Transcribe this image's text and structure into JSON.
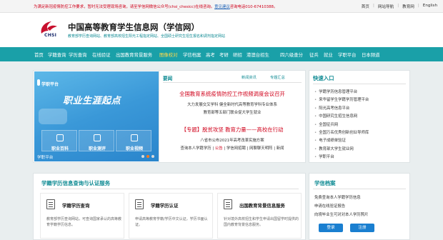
{
  "topbar": {
    "notice_before": "为满足新冠疫情防控工作要求，暂时无法受理现场咨询，请至学信网微信公众号(chsi_chesicc)在线咨询。",
    "notice_link": "意见建议",
    "notice_after": "咨询电话010-67410388。",
    "links": [
      "首页",
      "网站导航",
      "教育网",
      "English"
    ]
  },
  "header": {
    "logo_text": "CHSI",
    "title": "中国高等教育学生信息网（学信网）",
    "subtitle": "教育部学历查询网站、教育部高校招生阳光工程指定网站、全国硕士研究生招生报名和调剂指定网站"
  },
  "nav": {
    "items": [
      "首页",
      "学籍查询",
      "学历查询",
      "在线验证",
      "出国教育背景服务",
      "图像校对",
      "学信档案",
      "高考",
      "考研",
      "研招",
      "港澳台招生",
      "四六级查分",
      "征兵",
      "就业",
      "学职平台",
      "日本频道"
    ],
    "highlight_index": 5
  },
  "banner": {
    "logo": "学职平台",
    "title": "职业生涯起点",
    "boxes": [
      "职业百科",
      "职业测评",
      "职业视频"
    ],
    "caption": "学职平台",
    "slide_count": 3,
    "active_slide": 1
  },
  "news": {
    "tab": "要闻",
    "right_tabs": [
      "新闻资讯",
      "专题汇总"
    ],
    "headline1": "全国教育系统疫情防控工作视频调度会议召开",
    "line1": "大力发展交叉学科 健全新时代高等教育学科专业体系",
    "line2": "教育部等五部门联合促大学生就业",
    "headline2": "【专题】脱贫攻坚 教育力量——高校在行动",
    "line3": "八省市公布2021年高考改革实施方案",
    "line4_parts": [
      "查询本人学籍学历",
      "公告",
      "学信网招聘",
      "网聊聊天明阵",
      "新闻"
    ]
  },
  "quick": {
    "title": "快速入口",
    "items": [
      "学籍学历信息管理平台",
      "来华留学生学籍学历管理平台",
      "阳光高考信息平台",
      "中国研究生招生信息网",
      "全国征兵网",
      "全国万名优秀创新创业导师库",
      "电子成绩单验证",
      "教育部大学生就业网",
      "学职平台"
    ]
  },
  "query": {
    "title": "学籍学历信息查询与认证服务",
    "cards": [
      {
        "title": "学籍学历查询",
        "desc": "教育部学历查询网站，可查询国家承认的高等教育学籍学历信息。"
      },
      {
        "title": "学籍学历认证",
        "desc": "申请高等教育学籍/学历中文认证，学历书面认证。"
      },
      {
        "title": "出国教育背景信息服务",
        "desc": "针对境外高校招生和学生申请出国留学时提供的国内教育背景信息服务。"
      }
    ]
  },
  "archive": {
    "title": "学信档案",
    "lines": [
      "免费查询本人学籍学历信息",
      "申请在线验证报告",
      "向境毕业生可对对本人学历照片"
    ],
    "login": "登录",
    "register": "注册"
  }
}
